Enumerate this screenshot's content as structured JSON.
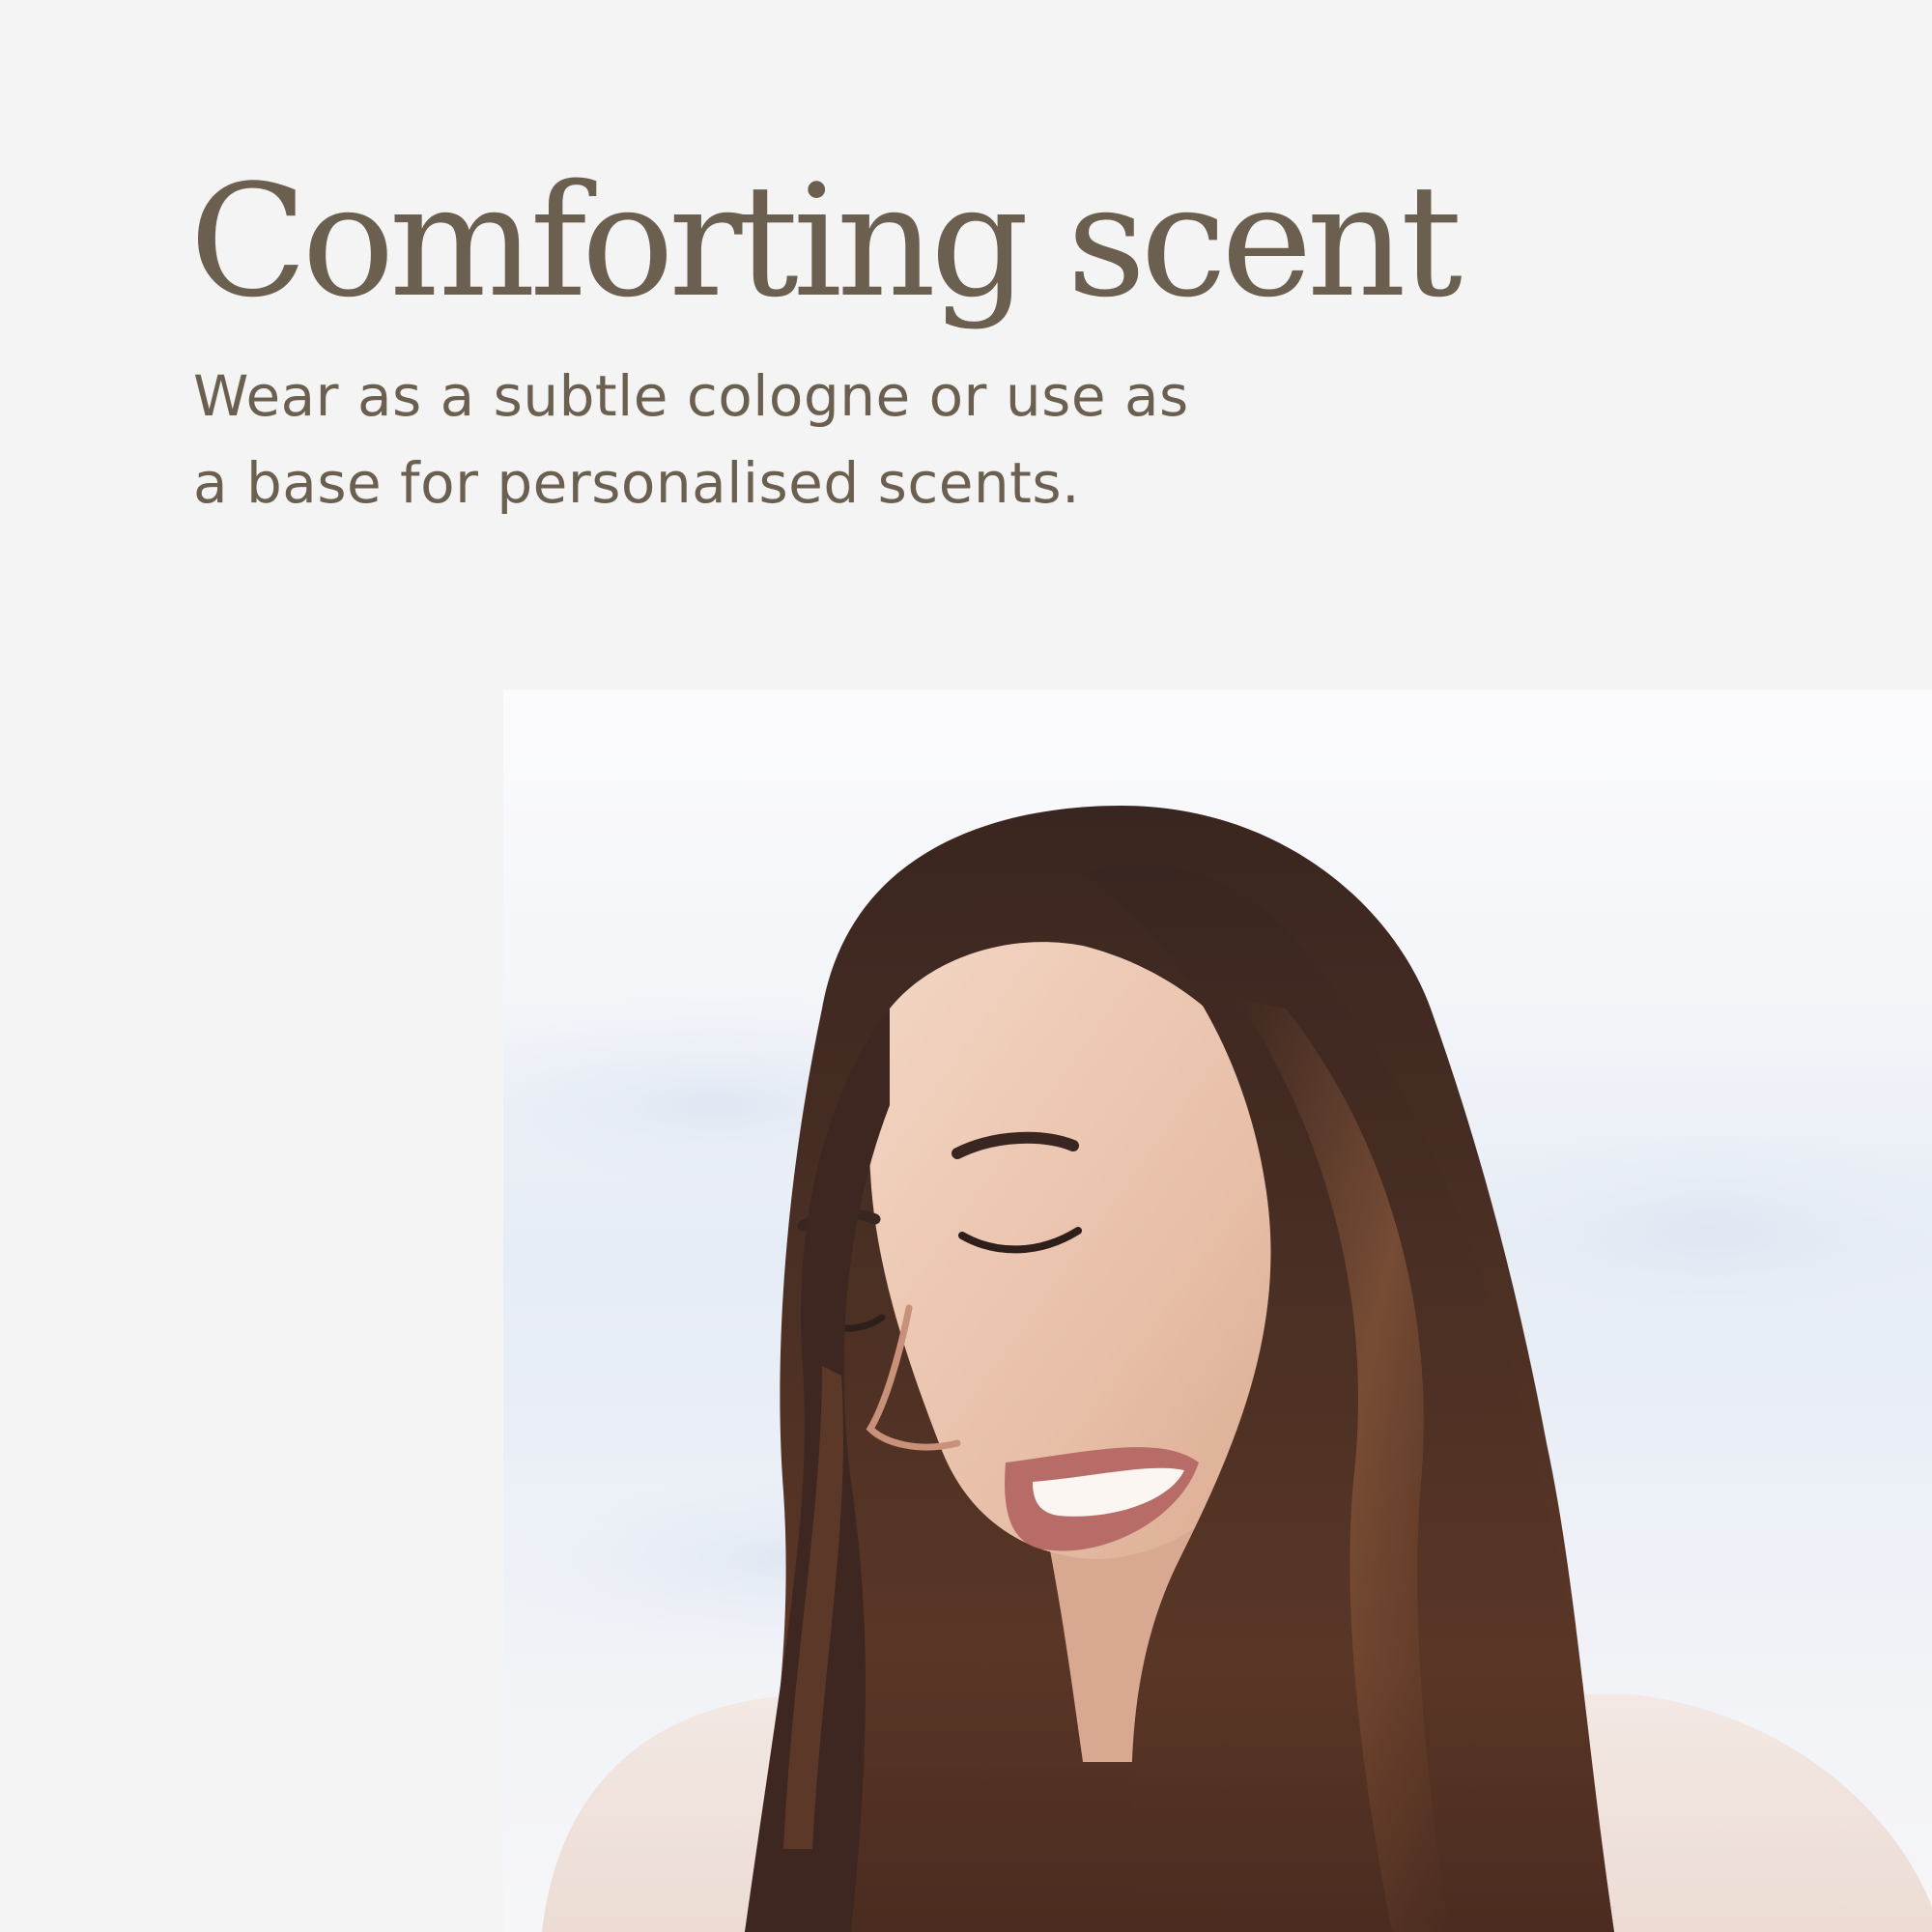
{
  "headline": "Comforting scent",
  "subcopy": {
    "line1": "Wear as a subtle cologne or use as",
    "line2": "a base for personalised scents."
  },
  "colors": {
    "background": "#f4f4f4",
    "text": "#6b6050"
  },
  "image": {
    "icon": "portrait-photo"
  }
}
